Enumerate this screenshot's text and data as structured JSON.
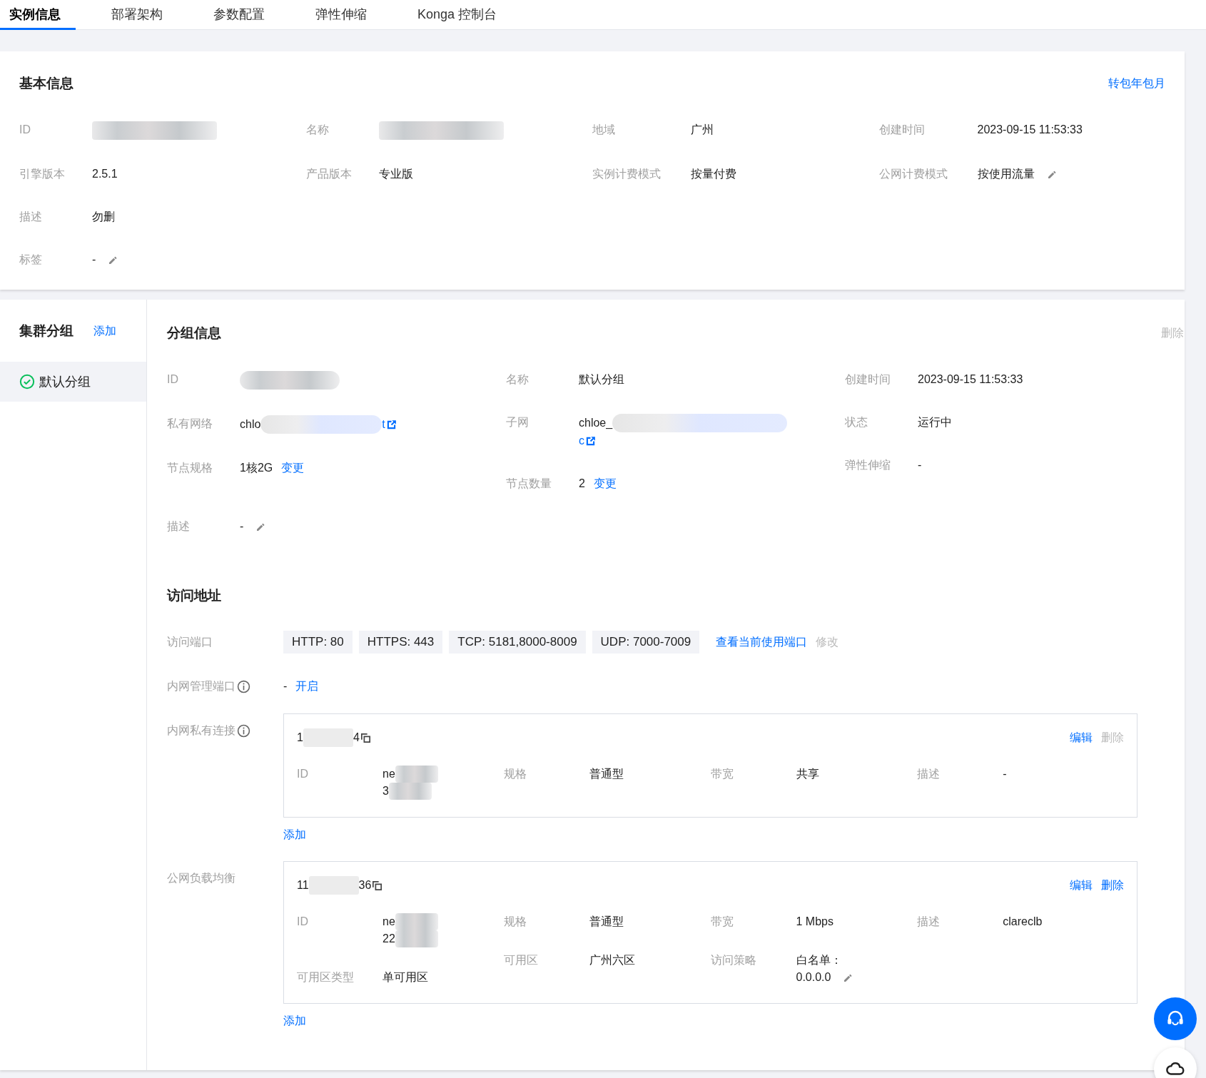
{
  "tabs": [
    {
      "label": "实例信息",
      "selected": true
    },
    {
      "label": "部署架构",
      "selected": false
    },
    {
      "label": "参数配置",
      "selected": false
    },
    {
      "label": "弹性伸缩",
      "selected": false
    },
    {
      "label": "Konga 控制台",
      "selected": false
    }
  ],
  "basic_info": {
    "title": "基本信息",
    "action": "转包年包月",
    "rows": [
      [
        {
          "label": "ID",
          "segments": [
            {
              "kind": "redacted"
            }
          ]
        },
        {
          "label": "名称",
          "segments": [
            {
              "kind": "redacted"
            }
          ]
        },
        {
          "label": "地域",
          "value": "广州"
        },
        {
          "label": "创建时间",
          "value": "2023-09-15 11:53:33"
        }
      ],
      [
        {
          "label": "引擎版本",
          "value": "2.5.1"
        },
        {
          "label": "产品版本",
          "value": "专业版"
        },
        {
          "label": "实例计费模式",
          "value": "按量付费"
        },
        {
          "label": "公网计费模式",
          "value": "按使用流量",
          "editable": true
        }
      ],
      [
        {
          "label": "描述",
          "value": "勿删"
        }
      ],
      [
        {
          "label": "标签",
          "value": "-",
          "editable": true
        }
      ]
    ]
  },
  "sidebar": {
    "title": "集群分组",
    "action": "添加",
    "items": [
      {
        "label": "默认分组",
        "selected": true,
        "healthy": true
      }
    ]
  },
  "group_info": {
    "title": "分组信息",
    "action": {
      "label": "删除",
      "disabled": true
    },
    "columns": [
      [
        {
          "label": "ID",
          "segments": [
            {
              "kind": "redacted"
            }
          ]
        },
        {
          "label": "私有网络",
          "segments": [
            {
              "kind": "text",
              "text": "chlo"
            },
            {
              "kind": "redacted"
            },
            {
              "kind": "link",
              "text": "t"
            }
          ],
          "external_link": true
        },
        {
          "label": "节点规格",
          "value": "1核2G",
          "link": "变更"
        }
      ],
      [
        {
          "label": "名称",
          "value": "默认分组"
        },
        {
          "label": "子网",
          "segments": [
            {
              "kind": "text",
              "text": "chloe_"
            },
            {
              "kind": "redacted"
            },
            {
              "kind": "link",
              "text": "c"
            }
          ],
          "external_link": true
        },
        {
          "label": "节点数量",
          "value": "2",
          "link": "变更"
        }
      ],
      [
        {
          "label": "创建时间",
          "value": "2023-09-15 11:53:33"
        },
        {
          "label": "状态",
          "value": "运行中"
        },
        {
          "label": "弹性伸缩",
          "value": "-"
        }
      ]
    ],
    "description": {
      "label": "描述",
      "value": "-",
      "editable": true
    }
  },
  "access": {
    "title": "访问地址",
    "ports": {
      "label": "访问端口",
      "tags": [
        "HTTP: 80",
        "HTTPS: 443",
        "TCP: 5181,8000-8009",
        "UDP: 7000-7009"
      ],
      "link": "查看当前使用端口",
      "action": {
        "label": "修改",
        "disabled": true
      }
    },
    "admin_port": {
      "label": "内网管理端口",
      "info": true,
      "value": "-",
      "link": "开启"
    },
    "private_links": {
      "label": "内网私有连接",
      "info": true,
      "add": "添加",
      "cards": [
        {
          "header": [
            {
              "kind": "text",
              "text": "1"
            },
            {
              "kind": "redacted"
            },
            {
              "kind": "text",
              "text": "4"
            }
          ],
          "actions": [
            {
              "label": "编辑",
              "disabled": false
            },
            {
              "label": "删除",
              "disabled": true
            }
          ],
          "columns": [
            [
              {
                "label": "ID",
                "segments": [
                  {
                    "kind": "text",
                    "text": "ne"
                  },
                  {
                    "kind": "redacted"
                  },
                  {
                    "kind": "break"
                  },
                  {
                    "kind": "text",
                    "text": "3"
                  },
                  {
                    "kind": "redacted"
                  }
                ]
              }
            ],
            [
              {
                "label": "规格",
                "value": "普通型"
              }
            ],
            [
              {
                "label": "带宽",
                "value": "共享"
              }
            ],
            [
              {
                "label": "描述",
                "value": "-"
              }
            ]
          ]
        }
      ]
    },
    "public_lb": {
      "label": "公网负载均衡",
      "add": "添加",
      "cards": [
        {
          "header": [
            {
              "kind": "text",
              "text": "11"
            },
            {
              "kind": "redacted"
            },
            {
              "kind": "text",
              "text": "36"
            }
          ],
          "actions": [
            {
              "label": "编辑",
              "disabled": false
            },
            {
              "label": "删除",
              "disabled": false
            }
          ],
          "columns": [
            [
              {
                "label": "ID",
                "segments": [
                  {
                    "kind": "text",
                    "text": "ne"
                  },
                  {
                    "kind": "redacted"
                  },
                  {
                    "kind": "break"
                  },
                  {
                    "kind": "text",
                    "text": "22"
                  },
                  {
                    "kind": "redacted"
                  }
                ]
              },
              {
                "label": "可用区类型",
                "value": "单可用区"
              }
            ],
            [
              {
                "label": "规格",
                "value": "普通型"
              },
              {
                "label": "可用区",
                "value": "广州六区"
              }
            ],
            [
              {
                "label": "带宽",
                "value": "1 Mbps"
              },
              {
                "label": "访问策略",
                "segments": [
                  {
                    "kind": "text",
                    "text": "白名单："
                  },
                  {
                    "kind": "break"
                  },
                  {
                    "kind": "text",
                    "text": "0.0.0.0"
                  }
                ],
                "editable": true
              }
            ],
            [
              {
                "label": "描述",
                "value": "clareclb"
              }
            ]
          ]
        }
      ]
    }
  }
}
